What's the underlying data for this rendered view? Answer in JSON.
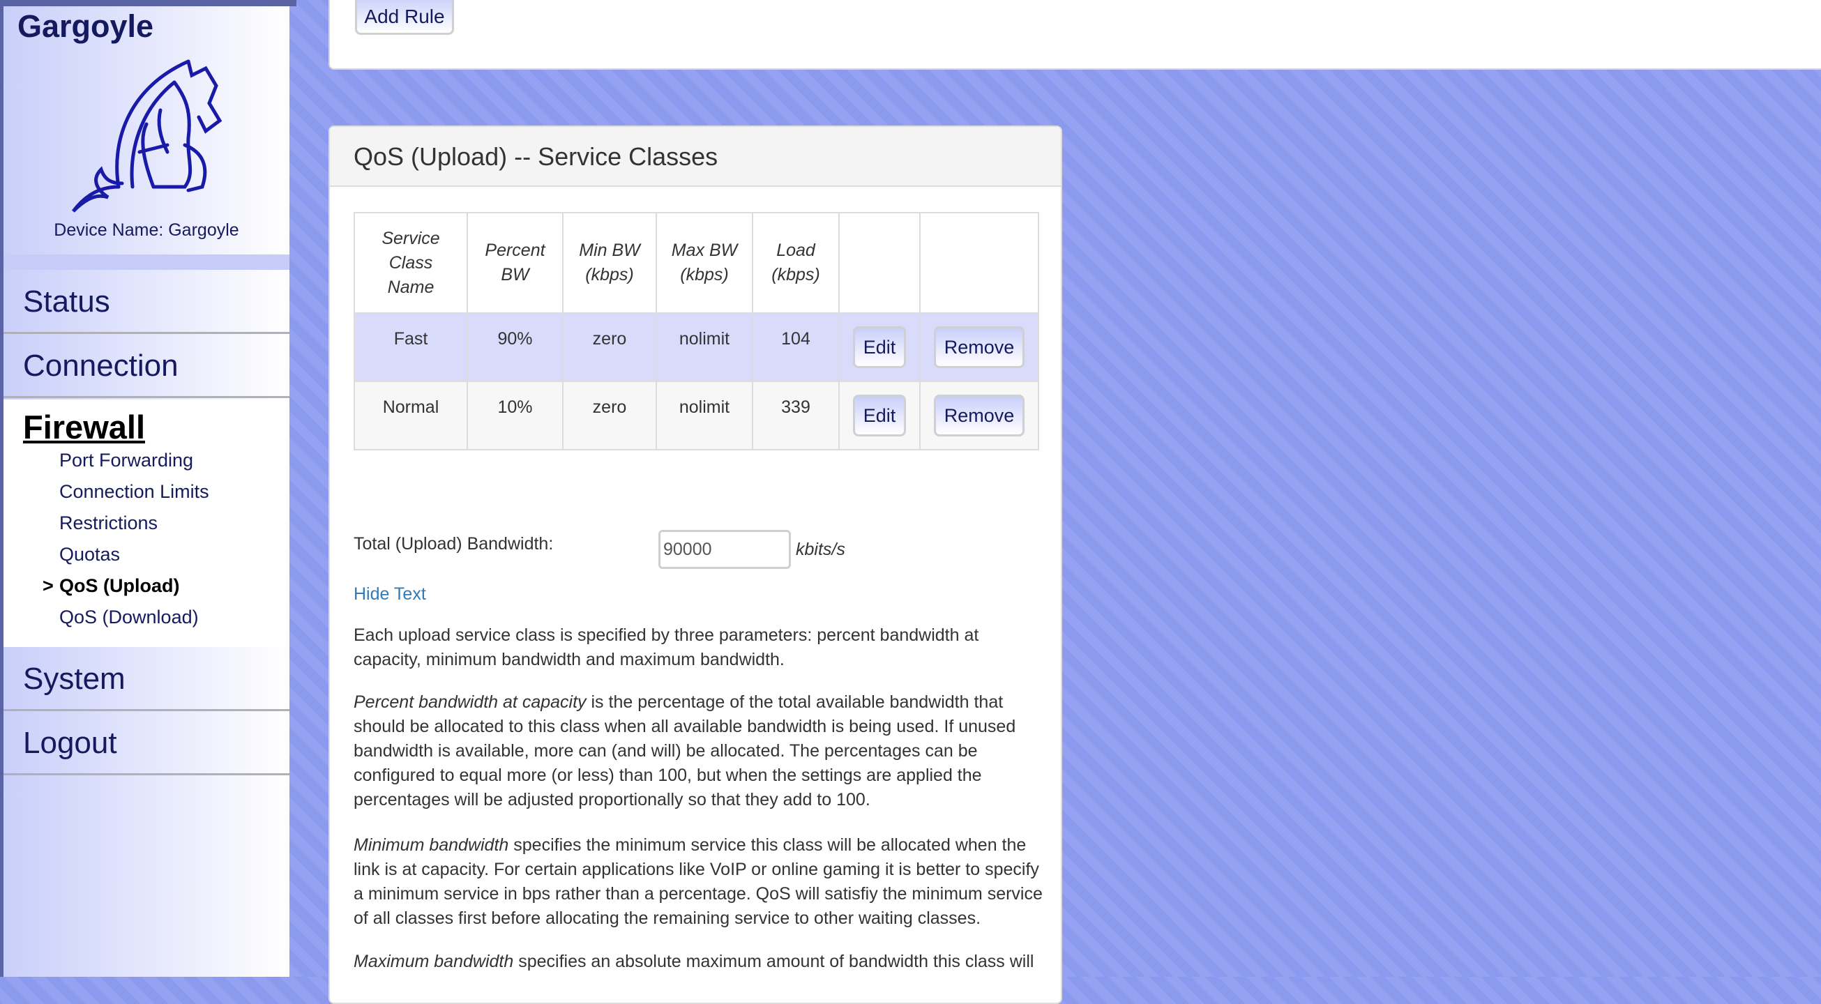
{
  "sidebar": {
    "brand": "Gargoyle",
    "device_name": "Device Name: Gargoyle",
    "nav": {
      "status": "Status",
      "connection": "Connection",
      "firewall": "Firewall",
      "system": "System",
      "logout": "Logout"
    },
    "firewall_items": [
      {
        "label": "Port Forwarding",
        "active": false
      },
      {
        "label": "Connection Limits",
        "active": false
      },
      {
        "label": "Restrictions",
        "active": false
      },
      {
        "label": "Quotas",
        "active": false
      },
      {
        "label": "QoS (Upload)",
        "active": true
      },
      {
        "label": "QoS (Download)",
        "active": false
      }
    ],
    "active_marker": ">"
  },
  "top_panel": {
    "add_rule_label": "Add Rule"
  },
  "service_classes": {
    "title": "QoS (Upload) -- Service Classes",
    "columns": {
      "name": [
        "Service",
        "Class",
        "Name"
      ],
      "percent": [
        "Percent",
        "BW"
      ],
      "min": [
        "Min BW",
        "(kbps)"
      ],
      "max": [
        "Max BW",
        "(kbps)"
      ],
      "load": [
        "Load",
        "(kbps)"
      ]
    },
    "rows": [
      {
        "name": "Fast",
        "percent": "90%",
        "min": "zero",
        "max": "nolimit",
        "load": "104",
        "edit": "Edit",
        "remove": "Remove"
      },
      {
        "name": "Normal",
        "percent": "10%",
        "min": "zero",
        "max": "nolimit",
        "load": "339",
        "edit": "Edit",
        "remove": "Remove"
      }
    ],
    "bandwidth_label": "Total (Upload) Bandwidth:",
    "bandwidth_value": "90000",
    "bandwidth_unit": "kbits/s",
    "hide_text_link": "Hide Text",
    "description": {
      "p1": "Each upload service class is specified by three parameters: percent bandwidth at capacity, minimum bandwidth and maximum bandwidth.",
      "p2_em": "Percent bandwidth at capacity",
      "p2": " is the percentage of the total available bandwidth that should be allocated to this class when all available bandwidth is being used. If unused bandwidth is available, more can (and will) be allocated. The percentages can be configured to equal more (or less) than 100, but when the settings are applied the percentages will be adjusted proportionally so that they add to 100.",
      "p3_em": "Minimum bandwidth",
      "p3": " specifies the minimum service this class will be allocated when the link is at capacity. For certain applications like VoIP or online gaming it is better to specify a minimum service in bps rather than a percentage. QoS will satisfiy the minimum service of all classes first before allocating the remaining service to other waiting classes.",
      "p4_em": "Maximum bandwidth",
      "p4": " specifies an absolute maximum amount of bandwidth this class will"
    }
  }
}
